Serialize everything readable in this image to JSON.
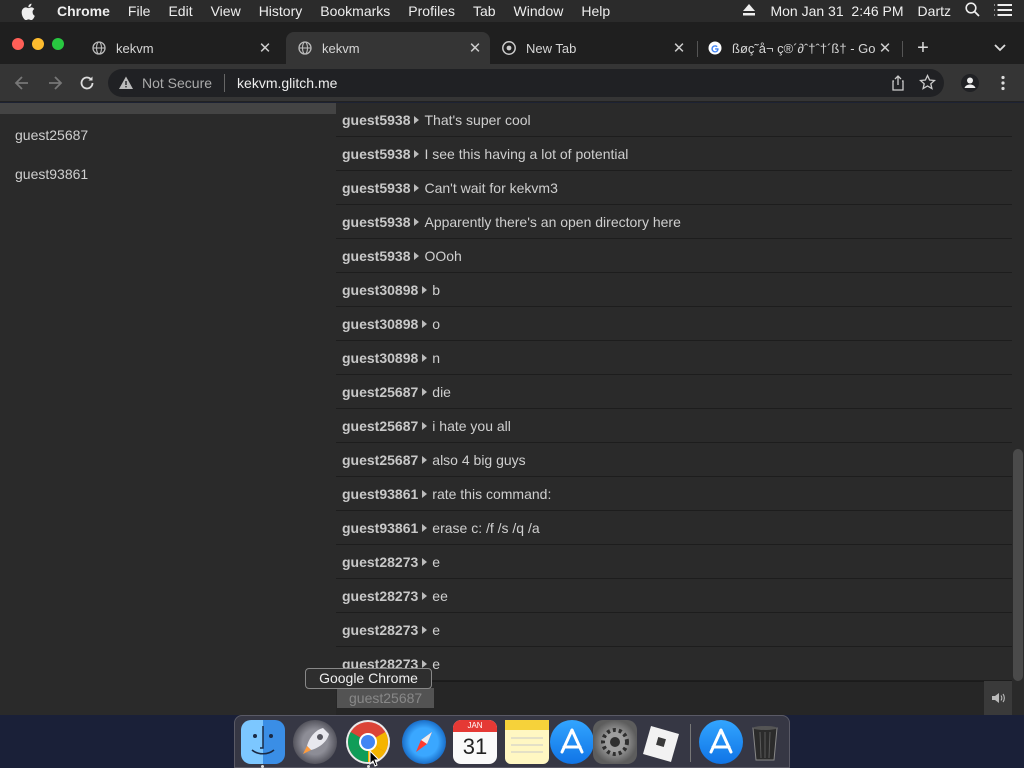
{
  "menubar": {
    "app": "Chrome",
    "items": [
      "File",
      "Edit",
      "View",
      "History",
      "Bookmarks",
      "Profiles",
      "Tab",
      "Window",
      "Help"
    ],
    "clock": "Mon Jan 31  2:46 PM",
    "user": "Dartz"
  },
  "tabs": [
    {
      "title": "kekvm",
      "active": false
    },
    {
      "title": "kekvm",
      "active": true
    },
    {
      "title": "New Tab",
      "active": false
    },
    {
      "title": "ßøç˜å¬ ç®´∂ˆ†ˆ†´ß† - Go",
      "active": false
    }
  ],
  "toolbar": {
    "security": "Not Secure",
    "url": "kekvm.glitch.me"
  },
  "sidebar": {
    "users": [
      "guest25687",
      "guest93861"
    ]
  },
  "chat": [
    {
      "user": "guest5938",
      "text": "That's super cool"
    },
    {
      "user": "guest5938",
      "text": "I see this having a lot of potential"
    },
    {
      "user": "guest5938",
      "text": "Can't wait for kekvm3"
    },
    {
      "user": "guest5938",
      "text": "Apparently there's an open directory here"
    },
    {
      "user": "guest5938",
      "text": "OOoh"
    },
    {
      "user": "guest30898",
      "text": "b"
    },
    {
      "user": "guest30898",
      "text": "o"
    },
    {
      "user": "guest30898",
      "text": "n"
    },
    {
      "user": "guest25687",
      "text": "die"
    },
    {
      "user": "guest25687",
      "text": "i hate you all"
    },
    {
      "user": "guest25687",
      "text": "also 4 big guys"
    },
    {
      "user": "guest93861",
      "text": "rate this command:"
    },
    {
      "user": "guest93861",
      "text": "erase c: /f /s /q /a"
    },
    {
      "user": "guest28273",
      "text": "e"
    },
    {
      "user": "guest28273",
      "text": "ee"
    },
    {
      "user": "guest28273",
      "text": "e"
    },
    {
      "user": "guest28273",
      "text": "e"
    }
  ],
  "tooltip": "Google Chrome",
  "drag_label": "guest25687",
  "dock": {
    "apps": [
      "finder-icon",
      "launchpad-icon",
      "chrome-icon",
      "safari-icon",
      "calendar-icon",
      "notes-icon",
      "app-store-icon",
      "system-preferences-icon",
      "roblox-icon",
      "app-store-folder-icon",
      "trash-icon"
    ],
    "calendar_month": "JAN",
    "calendar_day": "31"
  },
  "colors": {
    "page_bg": "#2a2a2a",
    "desktop": "#1a2038"
  }
}
